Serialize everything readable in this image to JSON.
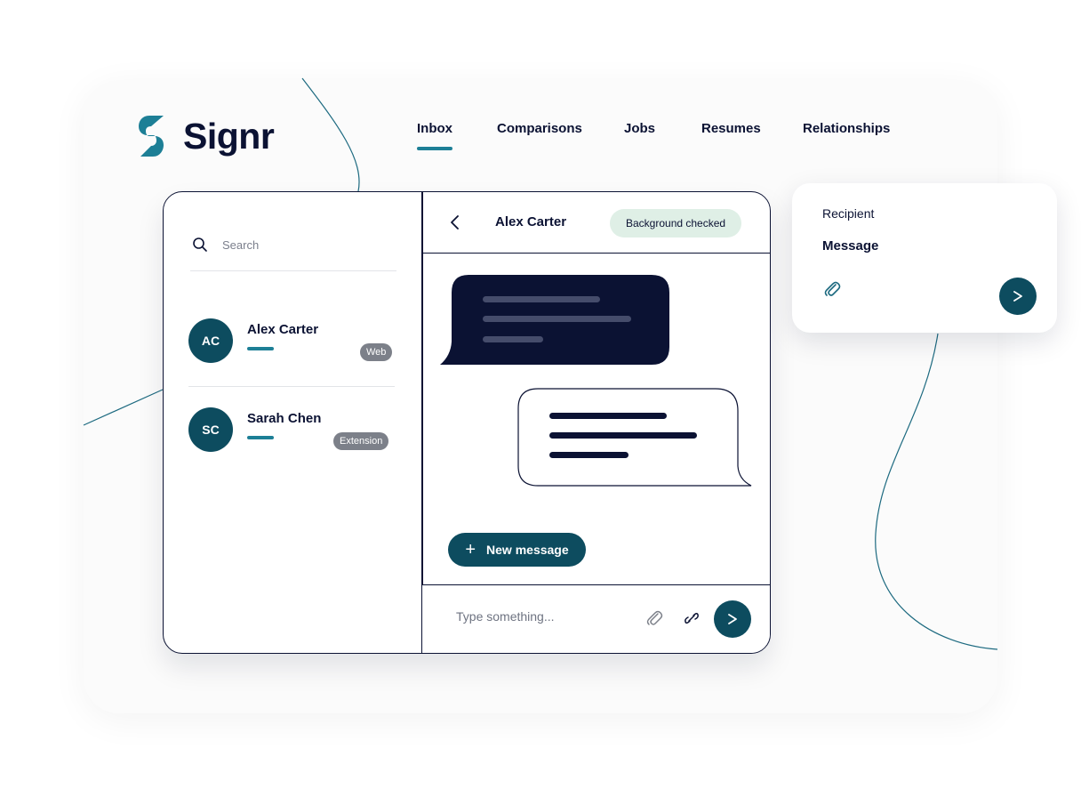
{
  "brand": {
    "name": "Signr",
    "accent": "#1d7f96",
    "primary": "#0d4c5f",
    "ink": "#0b1233"
  },
  "nav": {
    "tabs": [
      {
        "label": "Inbox",
        "active": true
      },
      {
        "label": "Comparisons",
        "active": false
      },
      {
        "label": "Jobs",
        "active": false
      },
      {
        "label": "Resumes",
        "active": false
      },
      {
        "label": "Relationships",
        "active": false
      }
    ]
  },
  "sidebar": {
    "search_placeholder": "Search",
    "contacts": [
      {
        "initials": "AC",
        "name": "Alex Carter",
        "tag": "Web"
      },
      {
        "initials": "SC",
        "name": "Sarah Chen",
        "tag": "Extension"
      }
    ]
  },
  "chat": {
    "title": "Alex Carter",
    "status_badge": "Background checked",
    "new_message_label": "New message",
    "composer_placeholder": "Type something..."
  },
  "compose_card": {
    "recipient_label": "Recipient",
    "message_label": "Message"
  }
}
